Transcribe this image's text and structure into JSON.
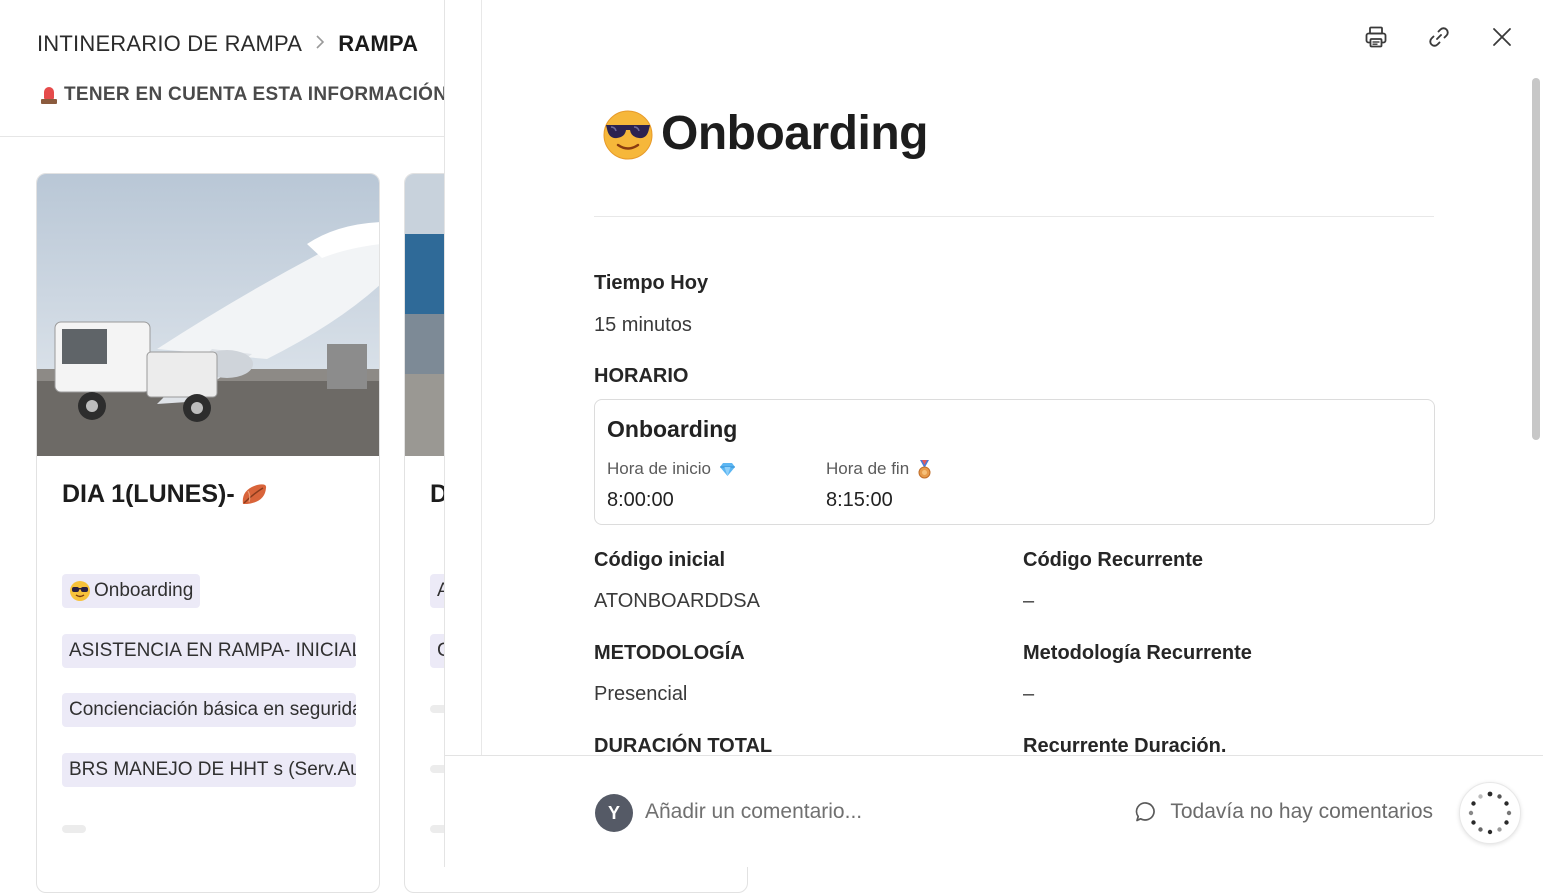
{
  "background": {
    "breadcrumb": {
      "parent": "INTINERARIO DE RAMPA",
      "separator": ">",
      "current": "RAMPA"
    },
    "notice": "TENER EN CUENTA ESTA INFORMACIÓN I",
    "cards": [
      {
        "title": "DIA 1(LUNES)-",
        "chips": [
          "Onboarding",
          "ASISTENCIA EN RAMPA- INICIAL",
          "Concienciación básica en seguridad",
          "BRS MANEJO DE HHT s (Serv.Aux"
        ]
      },
      {
        "title": "D",
        "chips": [
          "A",
          "C"
        ]
      }
    ]
  },
  "panel": {
    "title": "Onboarding",
    "title_icon": "sunglasses-face-emoji",
    "actions": {
      "print": "print-icon",
      "link": "link-icon",
      "close": "close-icon"
    },
    "properties": {
      "tiempo_hoy": {
        "label": "Tiempo Hoy",
        "value": "15 minutos"
      },
      "horario": {
        "label": "HORARIO",
        "card_title": "Onboarding",
        "start_label": "Hora de inicio",
        "start_value": "8:00:00",
        "end_label": "Hora de fin",
        "end_value": "8:15:00"
      },
      "codigo_inicial": {
        "label": "Código inicial",
        "value": "ATONBOARDDSA"
      },
      "codigo_recurrente": {
        "label": "Código Recurrente",
        "value": "–"
      },
      "metodologia": {
        "label": "METODOLOGÍA",
        "value": "Presencial"
      },
      "metodologia_recurrente": {
        "label": "Metodología Recurrente",
        "value": "–"
      },
      "duracion_total": {
        "label": "DURACIÓN TOTAL"
      },
      "recurrente_duracion": {
        "label": "Recurrente Duración."
      }
    },
    "footer": {
      "avatar_initial": "Y",
      "comment_placeholder": "Añadir un comentario...",
      "no_comments": "Todavía no hay comentarios"
    }
  },
  "colors": {
    "chip_bg": "#eceaf7",
    "avatar_bg": "#555a66",
    "text_primary": "#1d1d1d",
    "border": "#dcdcdc"
  }
}
